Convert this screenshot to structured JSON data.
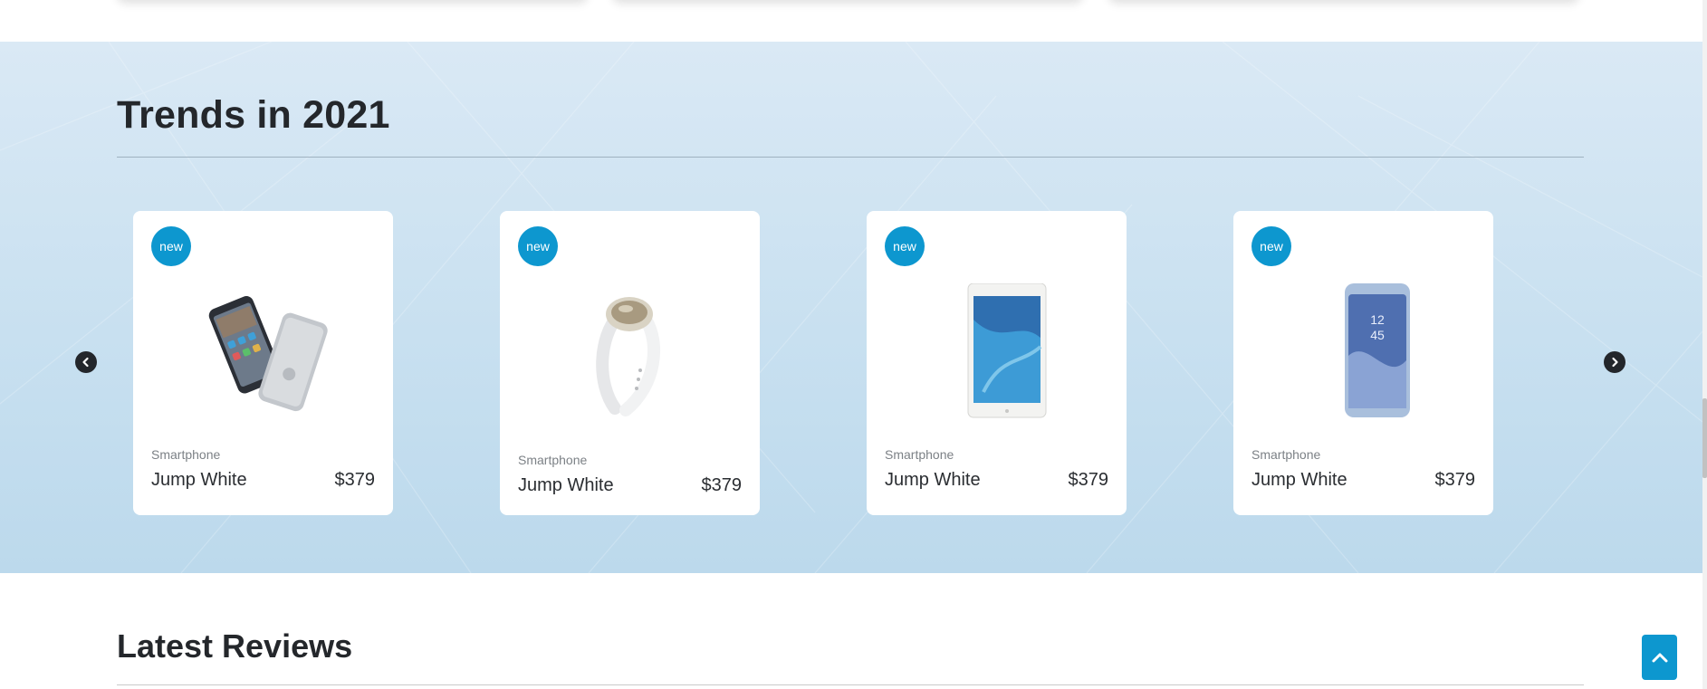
{
  "trends": {
    "title": "Trends in 2021",
    "products": [
      {
        "badge": "new",
        "category": "Smartphone",
        "name": "Jump White",
        "price": "$379",
        "image_icon": "dual-smartphone-image"
      },
      {
        "badge": "new",
        "category": "Smartphone",
        "name": "Jump White",
        "price": "$379",
        "image_icon": "fitness-band-image"
      },
      {
        "badge": "new",
        "category": "Smartphone",
        "name": "Jump White",
        "price": "$379",
        "image_icon": "tablet-image"
      },
      {
        "badge": "new",
        "category": "Smartphone",
        "name": "Jump White",
        "price": "$379",
        "image_icon": "smartphone-image"
      }
    ],
    "prev_icon": "chevron-left-circle-icon",
    "next_icon": "chevron-right-circle-icon"
  },
  "reviews": {
    "title": "Latest Reviews"
  },
  "back_to_top": {
    "icon": "chevron-up-icon"
  },
  "colors": {
    "accent": "#0d97cf",
    "band_top": "#dae9f5",
    "band_bottom": "#bcd9ec",
    "heading": "#24272b"
  }
}
